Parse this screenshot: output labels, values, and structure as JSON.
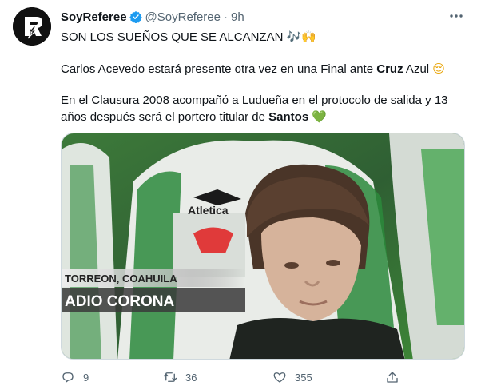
{
  "tweet": {
    "author_name": "SoyReferee",
    "author_handle": "@SoyReferee",
    "time": "9h",
    "line1": "SON LOS SUEÑOS QUE SE ALCANZAN",
    "line1_emoji": "🎶🙌",
    "p2_a": "Carlos Acevedo estará presente otra vez en una Final ante ",
    "p2_bold": "Cruz",
    "p2_b": " Azul",
    "p2_emoji": "😌",
    "p3_a": "En el Clausura 2008 acompañó a Ludueña en el protocolo de salida y 13",
    "p3_b": "años después será el portero titular de ",
    "p3_bold": "Santos",
    "p3_emoji": "💚"
  },
  "media": {
    "overlay_location": "TORREON, COAHUILA",
    "overlay_stadium": "ADIO CORONA",
    "jersey_sponsor": "Atletica"
  },
  "actions": {
    "replies": "9",
    "retweets": "36",
    "likes": "355"
  },
  "colors": {
    "verified": "#1d9bf0",
    "secondary_text": "#536471",
    "accent_green": "#2e8b3a"
  }
}
